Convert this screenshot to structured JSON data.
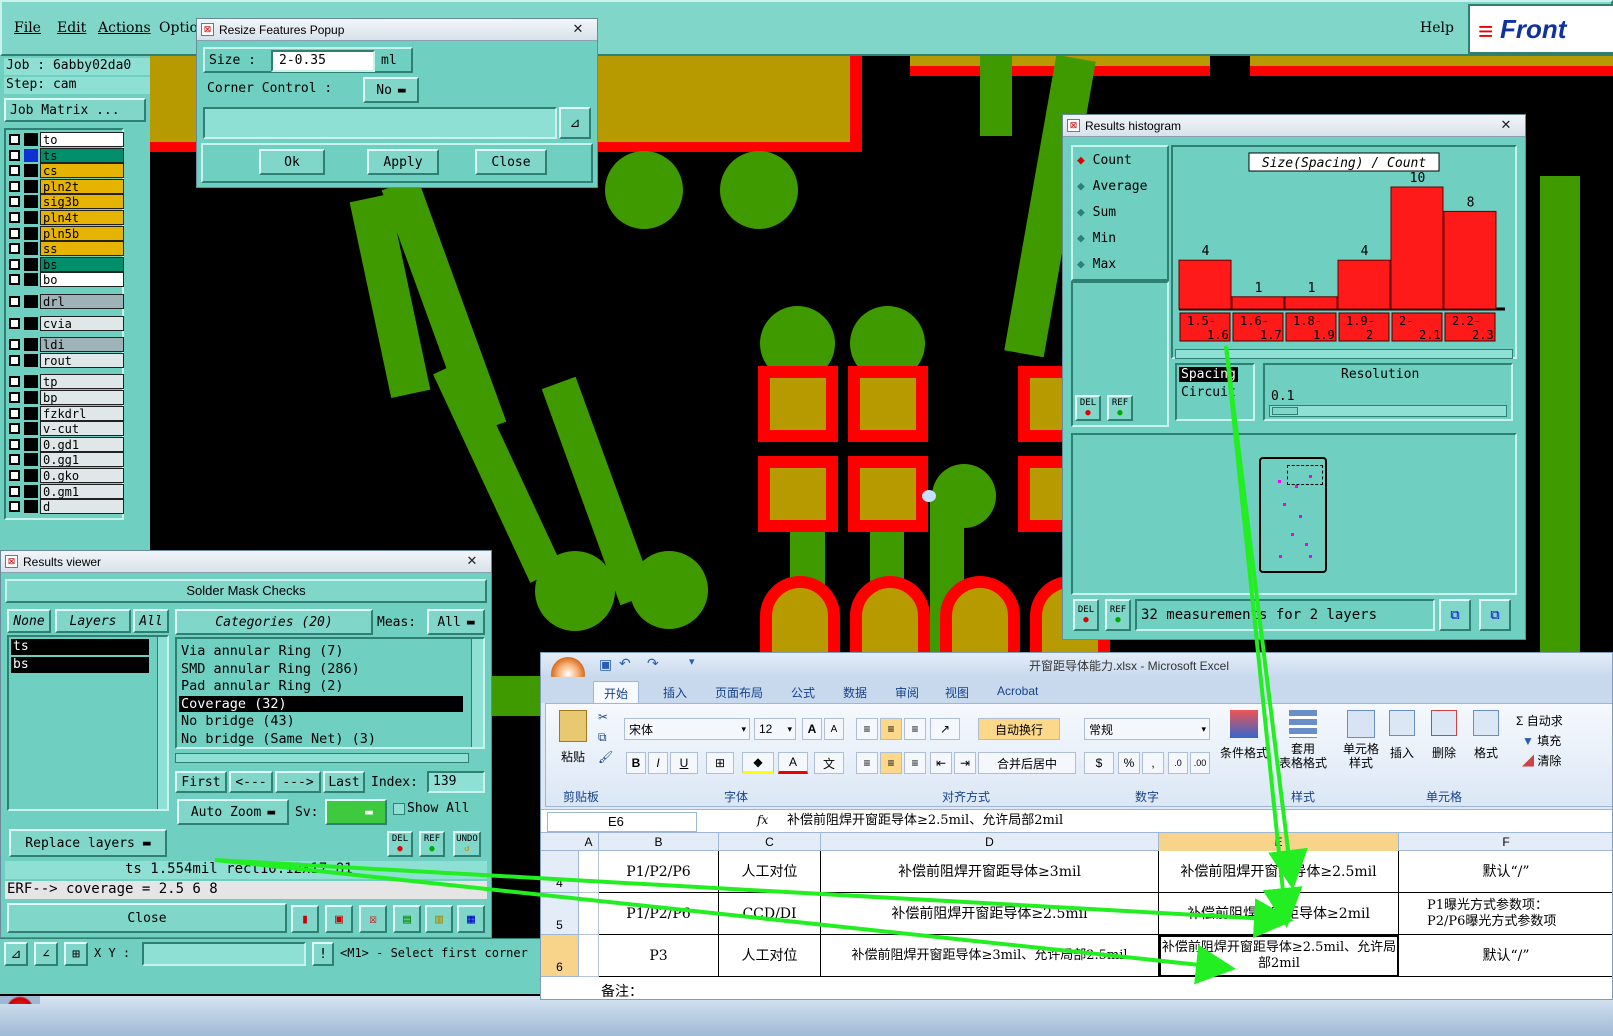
{
  "menu": {
    "items": [
      "File",
      "Edit",
      "Actions",
      "Optio"
    ],
    "help": "Help",
    "brand": "Front"
  },
  "job": {
    "job_line": "Job : 6abby02da0",
    "step_line": "Step: cam",
    "matrix_button": "Job Matrix ..."
  },
  "layers": [
    {
      "name": "to",
      "color": "#ffffff"
    },
    {
      "name": "ts",
      "color": "#008f6a"
    },
    {
      "name": "cs",
      "color": "#e5b300"
    },
    {
      "name": "pln2t",
      "color": "#e5b300"
    },
    {
      "name": "sig3b",
      "color": "#e5b300"
    },
    {
      "name": "pln4t",
      "color": "#e5b300"
    },
    {
      "name": "pln5b",
      "color": "#e5b300"
    },
    {
      "name": "ss",
      "color": "#e5b300"
    },
    {
      "name": "bs",
      "color": "#008f6a"
    },
    {
      "name": "bo",
      "color": "#ffffff"
    },
    {
      "name": "drl",
      "color": "#9fb2b8"
    },
    {
      "name": "cvia",
      "color": "#dfe7e8"
    },
    {
      "name": "ldi",
      "color": "#9fb2b8"
    },
    {
      "name": "rout",
      "color": "#dfe7e8"
    },
    {
      "name": "tp",
      "color": "#dfe7e8"
    },
    {
      "name": "bp",
      "color": "#dfe7e8"
    },
    {
      "name": "fzkdrl",
      "color": "#dfe7e8"
    },
    {
      "name": "v-cut",
      "color": "#dfe7e8"
    },
    {
      "name": "0.gd1",
      "color": "#dfe7e8"
    },
    {
      "name": "0.gg1",
      "color": "#dfe7e8"
    },
    {
      "name": "0.gko",
      "color": "#dfe7e8"
    },
    {
      "name": "0.gm1",
      "color": "#dfe7e8"
    },
    {
      "name": "d",
      "color": "#dfe7e8"
    }
  ],
  "resize_popup": {
    "title": "Resize Features Popup",
    "size_label": "Size :",
    "size_value": "2-0.35",
    "size_unit": "ml",
    "corner_label": "Corner Control :",
    "corner_value": "No",
    "ok": "Ok",
    "apply": "Apply",
    "close": "Close"
  },
  "histogram": {
    "title": "Results histogram",
    "modes": [
      "Count",
      "Average",
      "Sum",
      "Min",
      "Max"
    ],
    "chart_title": "Size(Spacing) / Count",
    "spacing": "Spacing",
    "circuit": "Circuit",
    "resolution_label": "Resolution",
    "resolution_value": "0.1",
    "status": "32 measurements for 2 layers",
    "del": "DEL",
    "ref": "REF"
  },
  "chart_data": {
    "type": "bar",
    "title": "Size(Spacing) / Count",
    "categories": [
      "1.5-1.6",
      "1.6-1.7",
      "1.8-1.9",
      "1.9-2",
      "2-2.1",
      "2.2-2.3"
    ],
    "values": [
      4,
      1,
      1,
      4,
      10,
      8
    ],
    "ylim": [
      0,
      10
    ]
  },
  "results_viewer": {
    "title": "Results viewer",
    "header": "Solder Mask Checks",
    "tab_none": "None",
    "tab_layers": "Layers",
    "tab_all": "All",
    "layers": [
      "ts",
      "bs"
    ],
    "categories_label": "Categories (20)",
    "meas_label": "Meas:",
    "meas_value": "All",
    "categories": [
      "Via annular Ring (7)",
      "SMD annular Ring (286)",
      "Pad annular Ring (2)",
      "Coverage (32)",
      "No bridge (43)",
      "No bridge (Same Net) (3)"
    ],
    "first": "First",
    "prev": "<---",
    "next": "--->",
    "last": "Last",
    "index_label": "Index:",
    "index_value": "139",
    "auto_zoom": "Auto Zoom",
    "sv_label": "Sv:",
    "show_all": "Show All",
    "replace_layers": "Replace layers",
    "del": "DEL",
    "ref": "REF",
    "undo": "UNDO",
    "status_line": "ts 1.554mil  rect10.12x17.81",
    "erf_line": "ERF--> coverage = 2.5 6 8",
    "close": "Close"
  },
  "bottom_bar": {
    "xy_label": "X Y :",
    "hint": "<M1> - Select first corner"
  },
  "excel": {
    "title": "开窗距导体能力.xlsx - Microsoft Excel",
    "tabs": [
      "开始",
      "插入",
      "页面布局",
      "公式",
      "数据",
      "审阅",
      "视图",
      "Acrobat"
    ],
    "paste": "粘贴",
    "font_name": "宋体",
    "font_size": "12",
    "wrap": "自动换行",
    "merge": "合并后居中",
    "number_format": "常规",
    "cond_format": "条件格式",
    "table_format": "套用\n表格格式",
    "cell_style": "单元格\n样式",
    "insert": "插入",
    "delete": "删除",
    "format": "格式",
    "autosum": "Σ 自动求",
    "fill": "填充",
    "clear": "清除",
    "groups": [
      "剪贴板",
      "字体",
      "对齐方式",
      "数字",
      "样式",
      "单元格"
    ],
    "name_box": "E6",
    "fx": "fx",
    "formula": "补偿前阻焊开窗距导体≥2.5mil、允许局部2mil",
    "columns": [
      "A",
      "B",
      "C",
      "D",
      "E",
      "F"
    ],
    "rows": [
      {
        "n": "4",
        "b": "P1/P2/P6",
        "c": "人工对位",
        "d": "补偿前阻焊开窗距导体≥3mil",
        "e": "补偿前阻焊开窗距导体≥2.5mil",
        "f": "默认“/”"
      },
      {
        "n": "5",
        "b": "P1/P2/P6",
        "c": "CCD/DI",
        "d": "补偿前阻焊开窗距导体≥2.5mil",
        "e": "补偿前阻焊开窗距导体≥2mil",
        "f": "P1曝光方式参数项：\nP2/P6曝光方式参数项"
      },
      {
        "n": "6",
        "b": "P3",
        "c": "人工对位",
        "d": "补偿前阻焊开窗距导体≥3mil、允许局部2.5mil",
        "e": "补偿前阻焊开窗距导体≥2.5mil、允许局部2mil",
        "f": "默认“/”"
      }
    ],
    "note": "备注："
  }
}
